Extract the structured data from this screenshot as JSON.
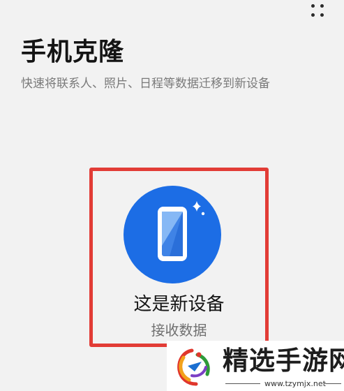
{
  "header": {
    "more_menu_icon": "more-dots-icon",
    "title": "手机克隆",
    "subtitle": "快速将联系人、照片、日程等数据迁移到新设备"
  },
  "device_option": {
    "icon": "phone-sparkle-icon",
    "title": "这是新设备",
    "subtitle": "接收数据",
    "highlight_color": "#e23c36",
    "icon_bg_color": "#1c6de5"
  },
  "watermark": {
    "logo_icon": "site-logo-icon",
    "text": "精选手游网",
    "url": "www.tzymjx.net"
  }
}
